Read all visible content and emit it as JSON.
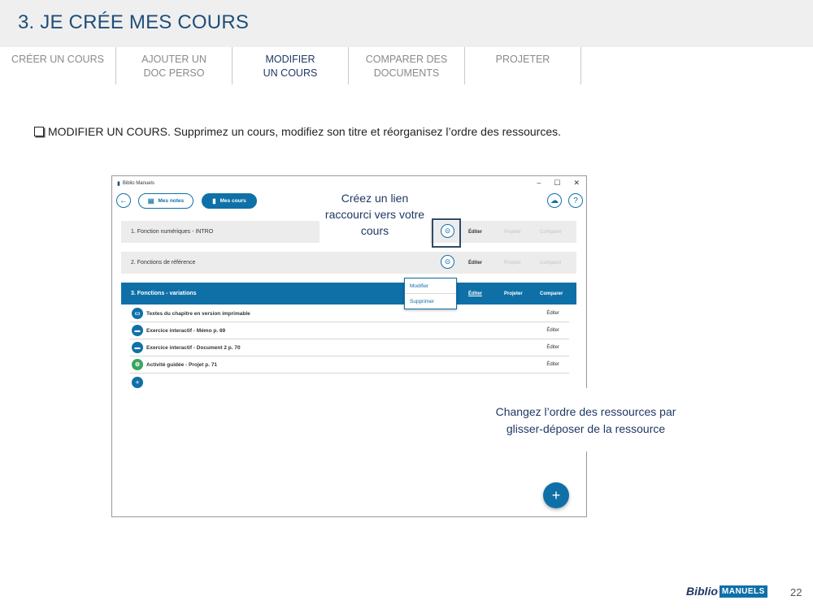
{
  "slide": {
    "title": "3. JE CRÉE MES COURS",
    "page_number": "22"
  },
  "tabs": [
    {
      "line1": "CRÉER UN COURS",
      "line2": ""
    },
    {
      "line1": "AJOUTER UN",
      "line2": "DOC PERSO"
    },
    {
      "line1": "MODIFIER",
      "line2": "UN COURS"
    },
    {
      "line1": "COMPARER DES",
      "line2": "DOCUMENTS"
    },
    {
      "line1": "PROJETER",
      "line2": ""
    }
  ],
  "instruction": "MODIFIER UN COURS. Supprimez un cours, modifiez son titre et réorganisez l’ordre des ressources.",
  "app": {
    "window_title": "Biblio Manuels",
    "pill_notes": "Mes notes",
    "pill_courses": "Mes cours",
    "courses": [
      {
        "name": "1. Fonction numériques - INTRO",
        "edit": "Éditer",
        "project": "Projeter",
        "compare": "Comparer"
      },
      {
        "name": "2. Fonctions de référence",
        "edit": "Éditer",
        "project": "Projeter",
        "compare": "Comparer"
      },
      {
        "name": "3. Fonctions - variations",
        "edit": "Éditer",
        "project": "Projeter",
        "compare": "Comparer"
      }
    ],
    "menu": {
      "modify": "Modifier",
      "delete": "Supprimer"
    },
    "resources": [
      {
        "label": "Textes du chapitre en version imprimable",
        "edit": "Éditer",
        "color": "#0f70a8",
        "icon": "printer-icon"
      },
      {
        "label": "Exercice interactif - Mémo p. 69",
        "edit": "Éditer",
        "color": "#0f70a8",
        "icon": "exercise-icon"
      },
      {
        "label": "Exercice interactif - Document 2 p. 70",
        "edit": "Éditer",
        "color": "#0f70a8",
        "icon": "exercise-icon"
      },
      {
        "label": "Activité guidée - Projet p. 71",
        "edit": "Éditer",
        "color": "#3aa55d",
        "icon": "activity-icon"
      }
    ]
  },
  "callouts": {
    "link": "Créez un lien raccourci vers votre cours",
    "reorder": "Changez l’ordre des ressources par glisser-déposer de la ressource"
  },
  "logo": {
    "part1": "Biblio",
    "part2": "MANUELS"
  },
  "colors": {
    "accent": "#0f70a8",
    "title": "#1f4e79",
    "green": "#3aa55d"
  }
}
